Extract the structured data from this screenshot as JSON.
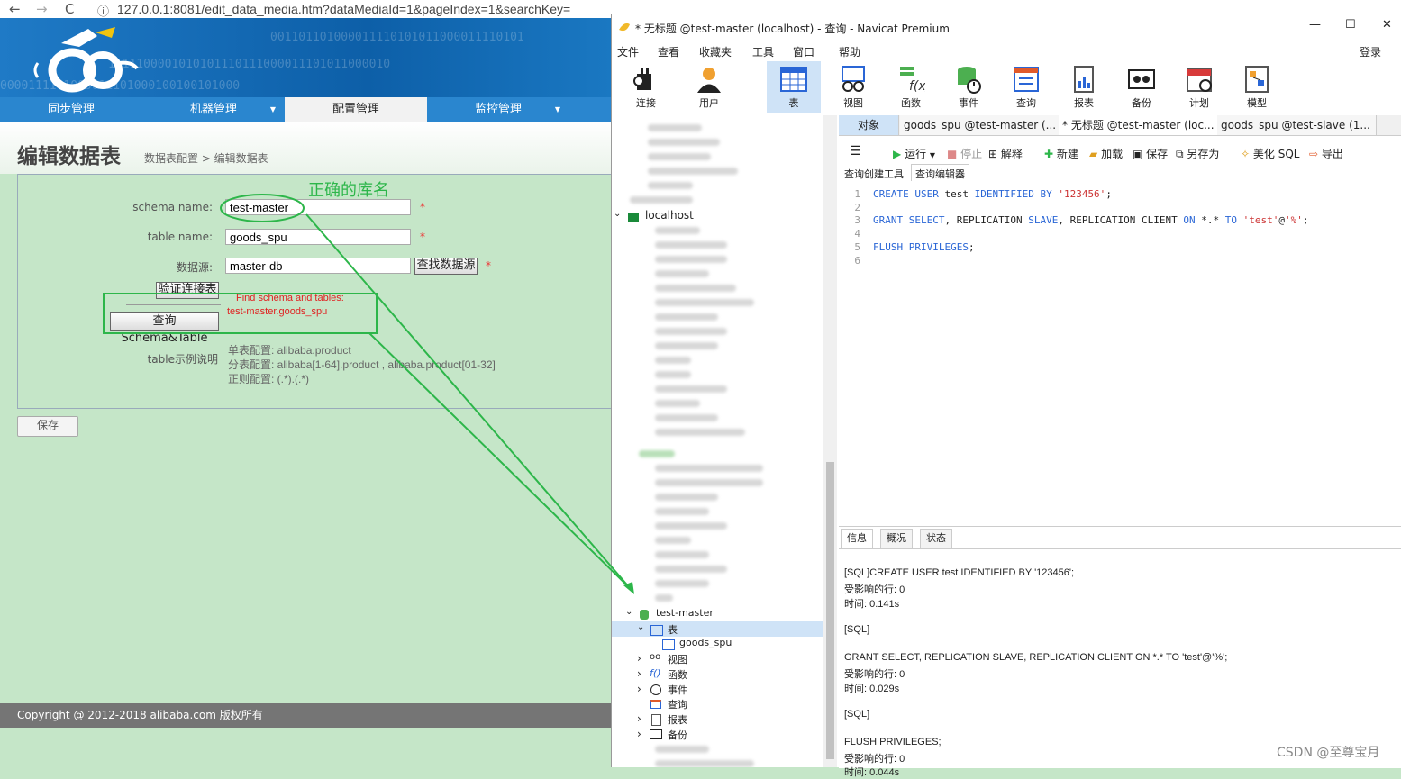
{
  "browser": {
    "back": "←",
    "forward": "→",
    "reload": "C",
    "info": "ⓘ",
    "url": "127.0.0.1:8081/edit_data_media.htm?dataMediaId=1&pageIndex=1&searchKey="
  },
  "banner": {
    "bits": [
      "0000111101000011101000100100101000",
      "1111100001010101110111000011101011000010",
      "001101101000011110101011000011110101"
    ]
  },
  "menu": {
    "items": [
      {
        "label": "同步管理",
        "caret": ""
      },
      {
        "label": "机器管理",
        "caret": "▼"
      },
      {
        "label": "配置管理",
        "caret": ""
      },
      {
        "label": "监控管理",
        "caret": "▼"
      }
    ]
  },
  "page": {
    "title": "编辑数据表",
    "breadcrumb": "数据表配置 > 编辑数据表"
  },
  "form": {
    "annotation_title": "正确的库名",
    "schema_label": "schema name:",
    "schema_value": "test-master",
    "table_label": "table name:",
    "table_value": "goods_spu",
    "source_label": "数据源:",
    "source_value": "master-db",
    "find_source_button": "查找数据源",
    "required_mark": "*",
    "verify_button": "验证连接表",
    "query_button": "查询Schema&Table",
    "find_note_1": "Find schema and tables:",
    "find_note_2": "test-master.goods_spu",
    "example_label": "table示例说明",
    "example_lines": [
      "单表配置: alibaba.product",
      "分表配置: alibaba[1-64].product , alibaba.product[01-32]",
      "正则配置: (.*).(.*)"
    ],
    "save_button": "保存"
  },
  "footer": {
    "copyright": "Copyright @ 2012-2018  alibaba.com  版权所有"
  },
  "navicat": {
    "title": "* 无标题 @test-master (localhost) - 查询 - Navicat Premium",
    "win_controls": [
      "—",
      "☐",
      "✕"
    ],
    "menu": [
      "文件",
      "查看",
      "收藏夹",
      "工具",
      "窗口",
      "帮助"
    ],
    "login": "登录",
    "toolbar": [
      "连接",
      "用户",
      "表",
      "视图",
      "函数",
      "事件",
      "查询",
      "报表",
      "备份",
      "计划",
      "模型"
    ],
    "tabs": [
      "对象",
      "goods_spu @test-master (...",
      "* 无标题 @test-master (loc...",
      "goods_spu @test-slave (1..."
    ],
    "tree": {
      "localhost": "localhost",
      "test_master": "test-master",
      "tables": "表",
      "goods_spu": "goods_spu",
      "views": "视图",
      "functions": "函数",
      "events": "事件",
      "queries": "查询",
      "reports": "报表",
      "backups": "备份"
    },
    "query_toolbar": {
      "menu_icon": "☰",
      "run": "运行",
      "stop": "停止",
      "explain": "解释",
      "new": "新建",
      "load": "加载",
      "save": "保存",
      "save_as": "另存为",
      "beautify": "美化 SQL",
      "export": "导出"
    },
    "subtabs": [
      "查询创建工具",
      "查询编辑器"
    ],
    "editor": {
      "line_numbers": [
        "1",
        "2",
        "3",
        "4",
        "5",
        "6"
      ],
      "l1_kw1": "CREATE USER",
      "l1_name": " test ",
      "l1_kw2": "IDENTIFIED BY",
      "l1_str": " '123456'",
      "l1_end": ";",
      "l3_kw1": "GRANT SELECT",
      "l3_mid": ", REPLICATION ",
      "l3_kw2": "SLAVE",
      "l3_mid2": ", REPLICATION CLIENT ",
      "l3_kw3": "ON",
      "l3_obj": " *.* ",
      "l3_kw4": "TO",
      "l3_str": " 'test'",
      "l3_at": "@",
      "l3_str2": "'%'",
      "l3_end": ";",
      "l5_kw": "FLUSH PRIVILEGES",
      "l5_end": ";"
    },
    "info_tabs": [
      "信息",
      "概况",
      "状态"
    ],
    "info_lines": [
      "[SQL]CREATE USER test IDENTIFIED BY '123456';",
      "受影响的行: 0",
      "时间: 0.141s",
      "[SQL]",
      "GRANT SELECT, REPLICATION SLAVE, REPLICATION CLIENT ON *.* TO 'test'@'%';",
      "受影响的行: 0",
      "时间: 0.029s",
      "[SQL]",
      "FLUSH PRIVILEGES;",
      "受影响的行: 0",
      "时间: 0.044s"
    ]
  },
  "watermark": "CSDN @至尊宝月",
  "colors": {
    "page_bg": "#c5e6c8",
    "menu_blue": "#2a86cf",
    "annotation_green": "#2db64a",
    "annotation_red": "#e02020",
    "keyword_blue": "#2a66d6"
  }
}
